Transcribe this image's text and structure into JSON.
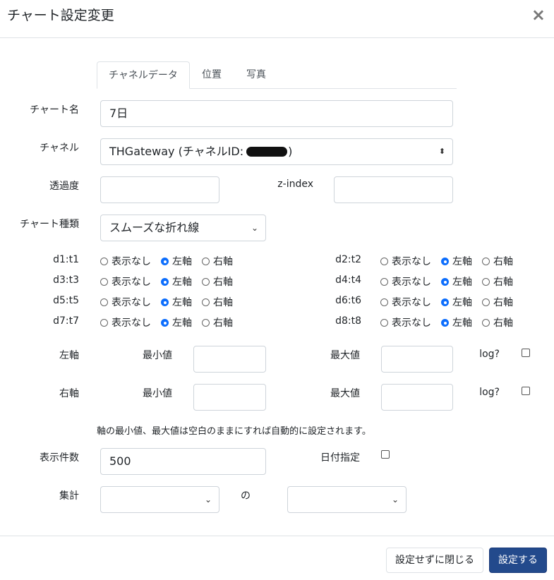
{
  "dialog": {
    "title": "チャート設定変更",
    "close_glyph": "×"
  },
  "tabs": [
    {
      "label": "チャネルデータ"
    },
    {
      "label": "位置"
    },
    {
      "label": "写真"
    }
  ],
  "form": {
    "chart_name": {
      "label": "チャート名",
      "value": "7日"
    },
    "channel": {
      "label": "チャネル",
      "value_prefix": "THGateway (チャネルID:",
      "value_suffix": ")"
    },
    "opacity": {
      "label": "透過度",
      "value": ""
    },
    "zindex": {
      "label": "z-index",
      "value": ""
    },
    "chart_type": {
      "label": "チャート種類",
      "value": "スムーズな折れ線"
    },
    "axis_options": [
      "表示なし",
      "左軸",
      "右軸"
    ],
    "channels": [
      {
        "label": "d1:t1",
        "selected": 1
      },
      {
        "label": "d2:t2",
        "selected": 1
      },
      {
        "label": "d3:t3",
        "selected": 1
      },
      {
        "label": "d4:t4",
        "selected": 1
      },
      {
        "label": "d5:t5",
        "selected": 1
      },
      {
        "label": "d6:t6",
        "selected": 1
      },
      {
        "label": "d7:t7",
        "selected": 1
      },
      {
        "label": "d8:t8",
        "selected": 1
      }
    ],
    "left_axis": {
      "label": "左軸",
      "min_label": "最小値",
      "max_label": "最大値",
      "log_label": "log?"
    },
    "right_axis": {
      "label": "右軸",
      "min_label": "最小値",
      "max_label": "最大値",
      "log_label": "log?"
    },
    "axis_note": "軸の最小値、最大値は空白のままにすれば自動的に設定されます。",
    "count": {
      "label": "表示件数",
      "value": "500"
    },
    "date_spec": {
      "label": "日付指定"
    },
    "aggregate": {
      "label": "集計",
      "connector": "の"
    }
  },
  "footer": {
    "close_label": "設定せずに閉じる",
    "save_label": "設定する"
  },
  "colors": {
    "primary": "#234a8c",
    "radio_checked": "#0d6efd",
    "border": "#ced4da"
  }
}
